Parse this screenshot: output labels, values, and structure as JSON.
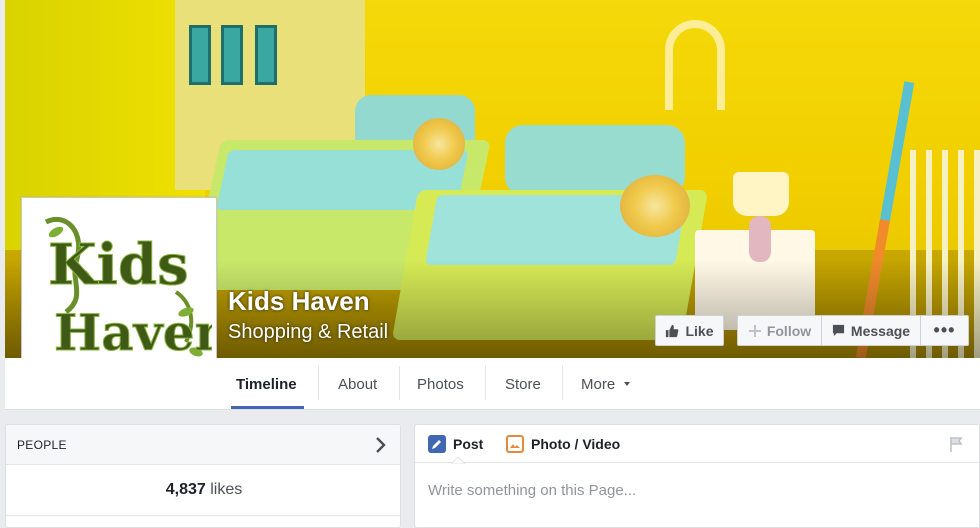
{
  "page": {
    "name": "Kids Haven",
    "category": "Shopping & Retail"
  },
  "cover_actions": {
    "like_label": "Like",
    "follow_label": "Follow",
    "message_label": "Message",
    "more_label": "•••"
  },
  "profile_logo": {
    "line1": "Kids",
    "line2": "Haven"
  },
  "nav": {
    "tabs": [
      {
        "label": "Timeline",
        "active": true
      },
      {
        "label": "About"
      },
      {
        "label": "Photos"
      },
      {
        "label": "Store"
      },
      {
        "label": "More"
      }
    ]
  },
  "people": {
    "header": "PEOPLE",
    "likes_count": "4,837",
    "likes_label": "likes"
  },
  "composer": {
    "tab_post": "Post",
    "tab_photo": "Photo / Video",
    "placeholder": "Write something on this Page..."
  },
  "colors": {
    "accent": "#4267b2",
    "cover_yellow": "#f2d000"
  },
  "icons": [
    "thumbs-up-icon",
    "plus-icon",
    "message-icon",
    "ellipsis-icon",
    "chevron-right-icon",
    "pencil-icon",
    "photo-icon",
    "flag-icon",
    "caret-down-icon"
  ]
}
